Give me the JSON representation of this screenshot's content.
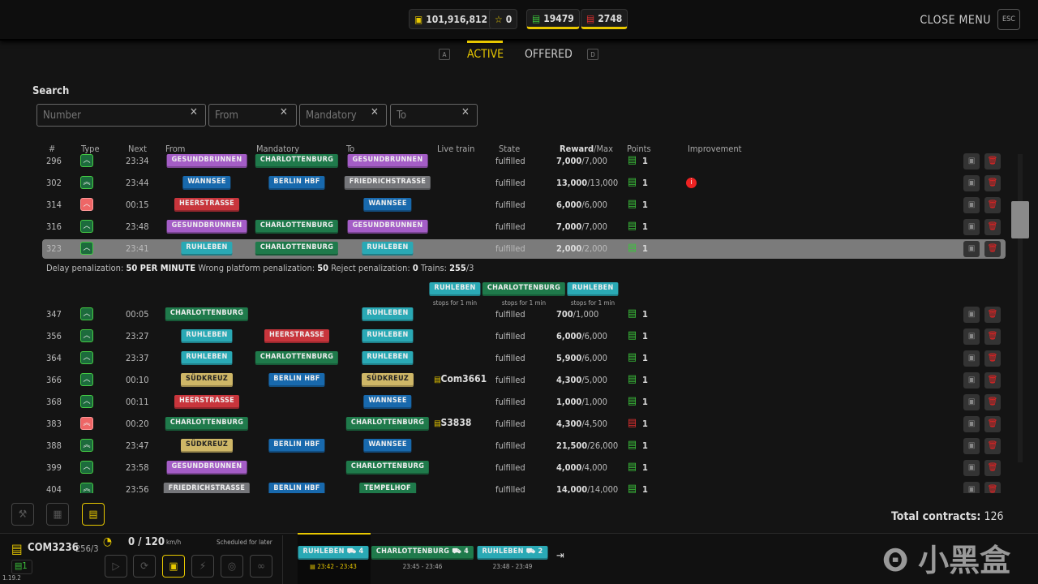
{
  "header": {
    "money": "101,916,812",
    "stars": "0",
    "green_trains": "19479",
    "red_trains": "2748",
    "close_menu": "CLOSE MENU",
    "esc": "ESC"
  },
  "tabs": {
    "key_left": "A",
    "active": "ACTIVE",
    "offered": "OFFERED",
    "key_right": "D"
  },
  "search": {
    "label": "Search",
    "number": "Number",
    "from": "From",
    "mandatory": "Mandatory",
    "to": "To"
  },
  "columns": {
    "num": "#",
    "type": "Type",
    "next": "Next",
    "from": "From",
    "mandatory": "Mandatory",
    "to": "To",
    "live": "Live train",
    "state": "State",
    "reward": "Reward",
    "max": "/Max",
    "points": "Points",
    "improvement": "Improvement"
  },
  "station_colors": {
    "Gesundbrunnen": "#a45dc6",
    "Charlottenburg": "#1f7a4b",
    "Wannsee": "#1869ad",
    "Berlin HBF": "#1869ad",
    "Friedrichstraße": "#75767a",
    "Heerstraße": "#c8353c",
    "Ruhleben": "#2aa9b5",
    "Südkreuz": "#cfb767",
    "Tempelhof": "#1f7a4b"
  },
  "rows_top": [
    {
      "num": "296",
      "type": "green",
      "double": false,
      "next": "23:34",
      "from": "Gesundbrunnen",
      "mand": "Charlottenburg",
      "to": "Gesundbrunnen",
      "live": "",
      "state": "fulfilled",
      "reward": "7,000",
      "max": "/7,000",
      "points": "1",
      "pcolor": "green",
      "imp": false
    },
    {
      "num": "302",
      "type": "green",
      "double": true,
      "next": "23:44",
      "from": "Wannsee",
      "mand": "Berlin HBF",
      "to": "Friedrichstraße",
      "live": "",
      "state": "fulfilled",
      "reward": "13,000",
      "max": "/13,000",
      "points": "1",
      "pcolor": "green",
      "imp": true
    },
    {
      "num": "314",
      "type": "red",
      "double": false,
      "next": "00:15",
      "from": "Heerstraße",
      "mand": "",
      "to": "Wannsee",
      "live": "",
      "state": "fulfilled",
      "reward": "6,000",
      "max": "/6,000",
      "points": "1",
      "pcolor": "green",
      "imp": false
    },
    {
      "num": "316",
      "type": "green",
      "double": false,
      "next": "23:48",
      "from": "Gesundbrunnen",
      "mand": "Charlottenburg",
      "to": "Gesundbrunnen",
      "live": "",
      "state": "fulfilled",
      "reward": "7,000",
      "max": "/7,000",
      "points": "1",
      "pcolor": "green",
      "imp": false
    },
    {
      "num": "323",
      "type": "green",
      "double": false,
      "next": "23:41",
      "from": "Ruhleben",
      "mand": "Charlottenburg",
      "to": "Ruhleben",
      "live": "",
      "state": "fulfilled",
      "reward": "2,000",
      "max": "/2,000",
      "points": "1",
      "pcolor": "green",
      "imp": false,
      "selected": true
    }
  ],
  "detail": {
    "delay_label": "Delay penalization:",
    "delay": "50 PER MINUTE",
    "wrong_label": "Wrong platform penalization:",
    "wrong": "50",
    "reject_label": "Reject penalization:",
    "reject": "0",
    "trains_label": "Trains:",
    "trains": "255",
    "trains_of": "/3",
    "stops": [
      {
        "name": "Ruhleben",
        "note": "stops for 1 min"
      },
      {
        "name": "Charlottenburg",
        "note": "stops for 1 min"
      },
      {
        "name": "Ruhleben",
        "note": "stops for 1 min"
      }
    ]
  },
  "rows_bottom": [
    {
      "num": "347",
      "type": "green",
      "double": false,
      "next": "00:05",
      "from": "Charlottenburg",
      "mand": "",
      "to": "Ruhleben",
      "live": "",
      "state": "fulfilled",
      "reward": "700",
      "max": "/1,000",
      "points": "1",
      "pcolor": "green",
      "imp": false
    },
    {
      "num": "356",
      "type": "green",
      "double": false,
      "next": "23:27",
      "from": "Ruhleben",
      "mand": "Heerstraße",
      "to": "Ruhleben",
      "live": "",
      "state": "fulfilled",
      "reward": "6,000",
      "max": "/6,000",
      "points": "1",
      "pcolor": "green",
      "imp": false
    },
    {
      "num": "364",
      "type": "green",
      "double": false,
      "next": "23:37",
      "from": "Ruhleben",
      "mand": "Charlottenburg",
      "to": "Ruhleben",
      "live": "",
      "state": "fulfilled",
      "reward": "5,900",
      "max": "/6,000",
      "points": "1",
      "pcolor": "green",
      "imp": false
    },
    {
      "num": "366",
      "type": "green",
      "double": false,
      "next": "00:10",
      "from": "Südkreuz",
      "mand": "Berlin HBF",
      "to": "Südkreuz",
      "live": "Com3661",
      "state": "fulfilled",
      "reward": "4,300",
      "max": "/5,000",
      "points": "1",
      "pcolor": "green",
      "imp": false
    },
    {
      "num": "368",
      "type": "green",
      "double": false,
      "next": "00:11",
      "from": "Heerstraße",
      "mand": "",
      "to": "Wannsee",
      "live": "",
      "state": "fulfilled",
      "reward": "1,000",
      "max": "/1,000",
      "points": "1",
      "pcolor": "green",
      "imp": false
    },
    {
      "num": "383",
      "type": "red",
      "double": true,
      "next": "00:20",
      "from": "Charlottenburg",
      "mand": "",
      "to": "Charlottenburg",
      "live": "S3838",
      "state": "fulfilled",
      "reward": "4,300",
      "max": "/4,500",
      "points": "1",
      "pcolor": "red",
      "imp": false
    },
    {
      "num": "388",
      "type": "green",
      "double": true,
      "next": "23:47",
      "from": "Südkreuz",
      "mand": "Berlin HBF",
      "to": "Wannsee",
      "live": "",
      "state": "fulfilled",
      "reward": "21,500",
      "max": "/26,000",
      "points": "1",
      "pcolor": "green",
      "imp": false
    },
    {
      "num": "399",
      "type": "green",
      "double": false,
      "next": "23:58",
      "from": "Gesundbrunnen",
      "mand": "",
      "to": "Charlottenburg",
      "live": "",
      "state": "fulfilled",
      "reward": "4,000",
      "max": "/4,000",
      "points": "1",
      "pcolor": "green",
      "imp": false
    },
    {
      "num": "404",
      "type": "green",
      "double": true,
      "next": "23:56",
      "from": "Friedrichstraße",
      "mand": "Berlin HBF",
      "to": "Tempelhof",
      "live": "",
      "state": "fulfilled",
      "reward": "14,000",
      "max": "/14,000",
      "points": "1",
      "pcolor": "green",
      "imp": false
    }
  ],
  "total": {
    "label": "Total contracts:",
    "value": "126"
  },
  "train": {
    "name": "COM3236",
    "cap": "256/3",
    "speed": "0 / 120",
    "unit": "km/h",
    "status": "Scheduled for later",
    "count": "1",
    "version": "1.19.2",
    "stops": [
      {
        "name": "Ruhleben",
        "platform": "4",
        "time": "23:42 - 23:43",
        "current": true
      },
      {
        "name": "Charlottenburg",
        "platform": "4",
        "time": "23:45 - 23:46",
        "current": false
      },
      {
        "name": "Ruhleben",
        "platform": "2",
        "time": "23:48 - 23:49",
        "current": false
      }
    ]
  },
  "watermark": "小黑盒",
  "colors": {
    "accent": "#e8c800",
    "green": "#3cc43c",
    "red": "#e23030"
  }
}
